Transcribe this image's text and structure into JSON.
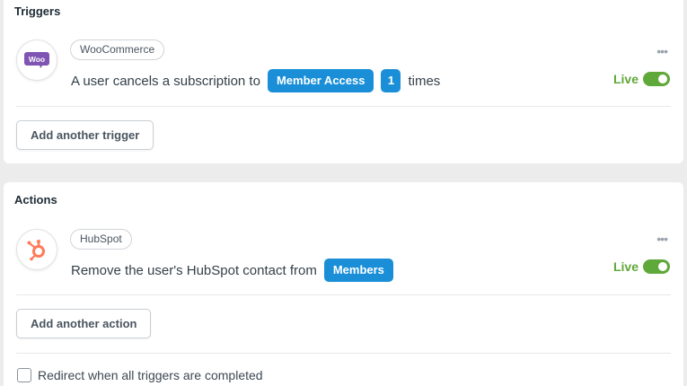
{
  "triggers": {
    "title": "Triggers",
    "item": {
      "integration": "WooCommerce",
      "logo_text": "Woo",
      "sentence_before": "A user cancels a subscription to",
      "token_product": "Member Access",
      "token_count": "1",
      "sentence_after": "times",
      "status": "Live",
      "more": "•••"
    },
    "add_button": "Add another trigger"
  },
  "actions": {
    "title": "Actions",
    "item": {
      "integration": "HubSpot",
      "sentence_before": "Remove the user's HubSpot contact from",
      "token_list": "Members",
      "status": "Live",
      "more": "•••"
    },
    "add_button": "Add another action"
  },
  "redirect": {
    "label": "Redirect when all triggers are completed",
    "checked": false
  },
  "colors": {
    "token": "#1a8fd8",
    "live": "#5fa83a",
    "woo": "#7f54b3",
    "hubspot": "#ff7a59"
  },
  "icons": {
    "woocommerce": "woocommerce-logo-icon",
    "hubspot": "hubspot-logo-icon",
    "more": "more-horizontal-icon",
    "toggle": "toggle-icon"
  }
}
